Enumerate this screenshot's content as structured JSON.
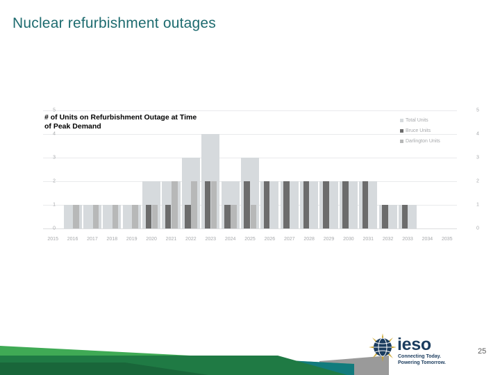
{
  "slide": {
    "title": "Nuclear refurbishment outages",
    "title_color": "#1d6b6f",
    "page_number": "25"
  },
  "branding": {
    "logo_wordmark": "ieso",
    "tagline_line1": "Connecting Today.",
    "tagline_line2": "Powering Tomorrow.",
    "logo_navy": "#1b3c5e",
    "logo_gold": "#c9a227",
    "band_green_light": "#3faa55",
    "band_green_dark": "#1f7a44",
    "band_teal": "#127b7d",
    "band_gray": "#9a9a9a"
  },
  "chart_data": {
    "type": "bar",
    "title": "# of Units on Refurbishment Outage at Time of Peak Demand",
    "title_line1": "# of Units on Refurbishment Outage at Time",
    "title_line2": "of Peak Demand",
    "xlabel": "",
    "ylabel": "",
    "ylim": [
      0,
      5
    ],
    "yticks": [
      0,
      1,
      2,
      3,
      4,
      5
    ],
    "ytick_labels": [
      "0",
      "1",
      "2",
      "3",
      "4",
      "5"
    ],
    "grid": true,
    "legend_position": "top-right",
    "dual_y_axis": true,
    "categories": [
      "2015",
      "2016",
      "2017",
      "2018",
      "2019",
      "2020",
      "2021",
      "2022",
      "2023",
      "2024",
      "2025",
      "2026",
      "2027",
      "2028",
      "2029",
      "2030",
      "2031",
      "2032",
      "2033",
      "2034",
      "2035"
    ],
    "series": [
      {
        "name": "Total Units",
        "color": "#d6dadd",
        "values": [
          0,
          1,
          1,
          1,
          1,
          2,
          2,
          3,
          4,
          2,
          3,
          2,
          2,
          2,
          2,
          2,
          2,
          1,
          1,
          0,
          0
        ]
      },
      {
        "name": "Bruce Units",
        "color": "#6c6c6c",
        "values": [
          0,
          0,
          0,
          0,
          0,
          1,
          1,
          1,
          2,
          1,
          2,
          2,
          2,
          2,
          2,
          2,
          2,
          1,
          1,
          0,
          0
        ]
      },
      {
        "name": "Darlington Units",
        "color": "#b7b8b8",
        "values": [
          0,
          1,
          1,
          1,
          1,
          1,
          2,
          2,
          2,
          1,
          1,
          0,
          0,
          0,
          0,
          0,
          0,
          0,
          0,
          0,
          0
        ]
      }
    ]
  }
}
